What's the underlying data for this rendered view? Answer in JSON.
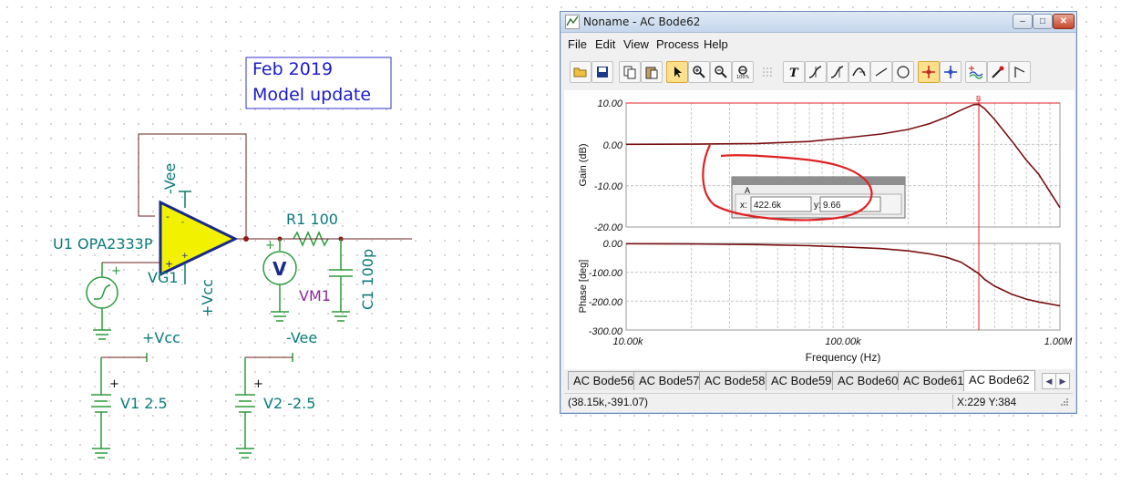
{
  "schematic": {
    "note_lines": [
      "Feb 2019",
      "Model update"
    ],
    "opamp_label": "U1 OPA2333P",
    "vee_pin_label": "-Vee",
    "vcc_pin_label": "+Vcc",
    "source_label": "VG1",
    "r1_label": "R1 100",
    "voltmeter_symbol": "V",
    "voltmeter_label": "VM1",
    "c1_label": "C1 100p",
    "vcc_rail_label": "+Vcc",
    "vee_rail_label": "-Vee",
    "v1_label": "V1 2.5",
    "v2_label": "V2 -2.5",
    "plus_sign": "+",
    "minus_sign": "-"
  },
  "window": {
    "title": "Noname - AC Bode62",
    "min_glyph": "–",
    "max_glyph": "□",
    "close_glyph": "✕"
  },
  "menu": [
    "File",
    "Edit",
    "View",
    "Process",
    "Help"
  ],
  "toolbar": {
    "icons": [
      "open-folder-icon",
      "save-icon",
      "copy-icon",
      "paste-icon",
      "select-arrow-icon",
      "zoom-in-icon",
      "zoom-out-icon",
      "zoom-100-icon",
      "grid-icon",
      "text-icon",
      "cursor-a-icon",
      "cursor-b-icon",
      "cursor-fz-icon",
      "line-icon",
      "circle-icon",
      "marker-cross-icon",
      "marker-cross-blue-icon",
      "curves-icon",
      "probe-icon",
      "step-icon"
    ],
    "active": [
      "select-arrow-icon",
      "marker-cross-icon"
    ],
    "text_glyph": "T"
  },
  "plot": {
    "gain_ylabel": "Gain (dB)",
    "gain_ticks": [
      "10.00",
      "0.00",
      "-10.00",
      "-20.00"
    ],
    "phase_ylabel": "Phase [deg]",
    "phase_ticks": [
      "0.00",
      "-100.00",
      "-200.00",
      "-300.00"
    ],
    "x_ticks": [
      "10.00k",
      "100.00k",
      "1.00M"
    ],
    "xlabel": "Frequency (Hz)",
    "marker_label": "B",
    "cursor_box": {
      "title": "A",
      "x_label": "x:",
      "x_value": "422.6k",
      "y_label": "y:",
      "y_value": "9.66"
    }
  },
  "chart_data": [
    {
      "type": "line",
      "xscale": "log",
      "xlim": [
        10000,
        1000000
      ],
      "ylim": [
        -20,
        10
      ],
      "ylabel": "Gain (dB)",
      "xlabel": "Frequency (Hz)",
      "grid": true,
      "series": [
        {
          "x": [
            10000,
            20000,
            40000,
            70000,
            100000,
            150000,
            200000,
            250000,
            300000,
            350000,
            400000,
            423000,
            450000,
            500000,
            600000,
            700000,
            800000,
            1000000
          ],
          "values": [
            0,
            0.05,
            0.2,
            0.7,
            1.5,
            2.5,
            3.6,
            5.0,
            6.6,
            8.3,
            9.6,
            9.66,
            8.6,
            6.0,
            0.8,
            -3.8,
            -7.3,
            -15.3
          ]
        }
      ]
    },
    {
      "type": "line",
      "xscale": "log",
      "xlim": [
        10000,
        1000000
      ],
      "ylim": [
        -300,
        0
      ],
      "ylabel": "Phase [deg]",
      "xlabel": "Frequency (Hz)",
      "grid": true,
      "series": [
        {
          "x": [
            10000,
            20000,
            40000,
            70000,
            100000,
            150000,
            200000,
            250000,
            300000,
            350000,
            400000,
            423000,
            450000,
            500000,
            600000,
            700000,
            800000,
            1000000
          ],
          "values": [
            -1,
            -2,
            -4,
            -8,
            -12,
            -18,
            -26,
            -36,
            -48,
            -65,
            -93,
            -105,
            -125,
            -148,
            -176,
            -193,
            -203,
            -216
          ]
        }
      ]
    }
  ],
  "tabs": [
    "AC Bode56",
    "AC Bode57",
    "AC Bode58",
    "AC Bode59",
    "AC Bode60",
    "AC Bode61",
    "AC Bode62"
  ],
  "active_tab": "AC Bode62",
  "tab_nav": {
    "prev": "◀",
    "next": "▶"
  },
  "status": {
    "left": "(38.15k,-391.07)",
    "right": "X:229  Y:384"
  }
}
